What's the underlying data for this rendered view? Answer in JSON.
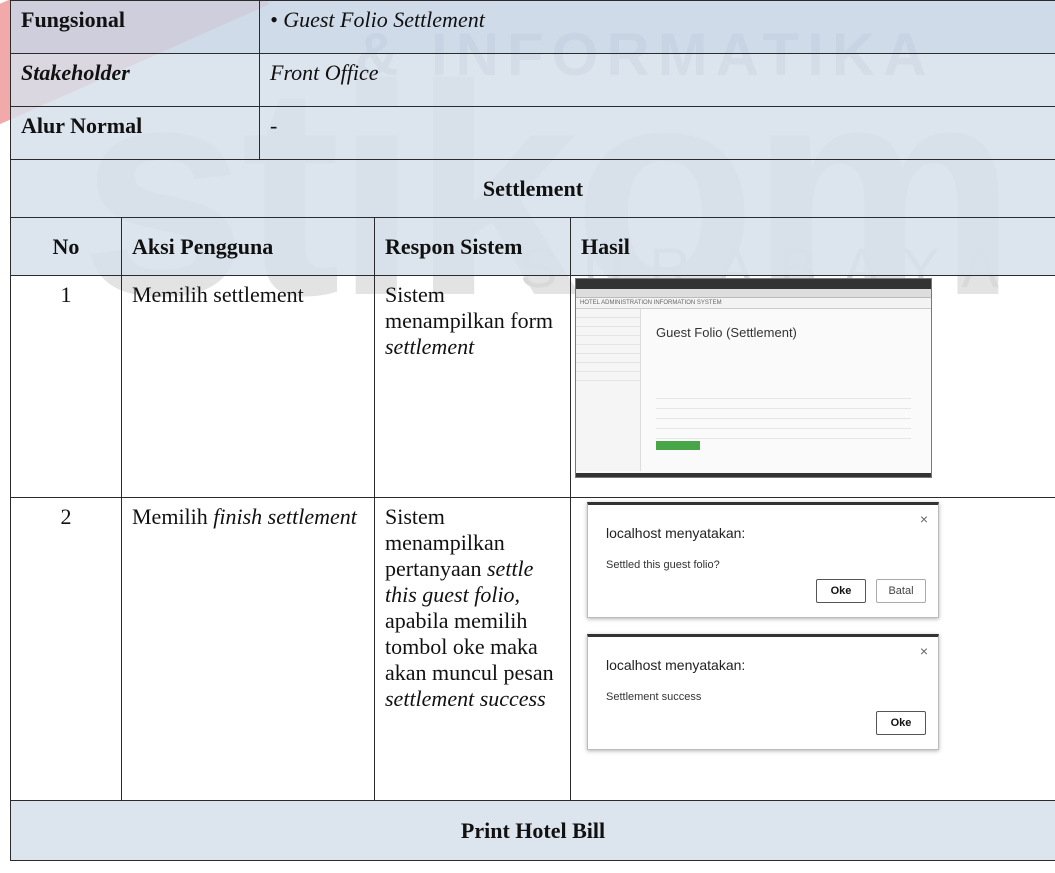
{
  "watermark": {
    "brand": "stikom",
    "inf": "& INFORMATIKA",
    "city": "SURABAYA"
  },
  "rows": {
    "fungsional_label": "Fungsional",
    "fungsional_value": "Guest Folio Settlement",
    "stakeholder_label": "Stakeholder",
    "stakeholder_value": "Front Office",
    "alur_label_bold": "Alur",
    "alur_label_rest": " Normal",
    "alur_value": "-"
  },
  "section_title": "Settlement",
  "headers": {
    "no": "No",
    "aksi": "Aksi Pengguna",
    "respon": "Respon Sistem",
    "hasil": "Hasil"
  },
  "steps": [
    {
      "no": "1",
      "aksi": "Memilih settlement",
      "respon_a": "Sistem menampilkan form ",
      "respon_b": "settlement",
      "shot_title": "Guest Folio (Settlement)",
      "shot_app": "HOTEL ADMINISTRATION INFORMATION SYSTEM"
    },
    {
      "no": "2",
      "aksi_a": "Memilih ",
      "aksi_b": "finish settlement",
      "respon_1": "Sistem menampilkan pertanyaan ",
      "respon_2": "settle this guest folio,",
      "respon_3": " apabila memilih tombol oke maka akan muncul pesan ",
      "respon_4": "settlement success",
      "dialog1": {
        "title": "localhost menyatakan:",
        "message": "Settled this guest folio?",
        "ok": "Oke",
        "cancel": "Batal"
      },
      "dialog2": {
        "title": "localhost menyatakan:",
        "message": "Settlement success",
        "ok": "Oke"
      },
      "close_glyph": "×"
    }
  ],
  "footer_title": "Print Hotel Bill"
}
